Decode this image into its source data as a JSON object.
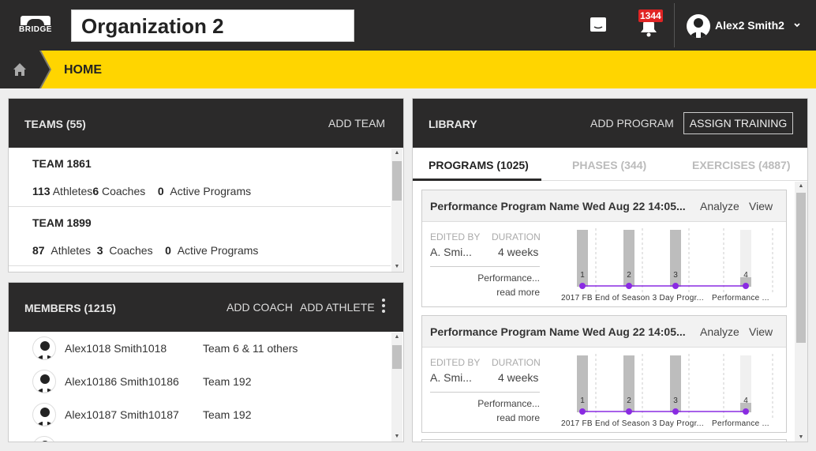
{
  "header": {
    "logo_text": "BRIDGE",
    "organization": "Organization 2",
    "notification_count": "1344",
    "user_name": "Alex2 Smith2"
  },
  "breadcrumb": {
    "current": "HOME"
  },
  "teams": {
    "title": "TEAMS (55)",
    "add_label": "ADD TEAM",
    "rows": [
      {
        "name": "TEAM 1861",
        "athletes": "113",
        "athletes_label": "Athletes",
        "coaches": "6",
        "coaches_label": "Coaches",
        "programs": "0",
        "programs_label": "Active Programs"
      },
      {
        "name": "TEAM 1899",
        "athletes": "87",
        "athletes_label": "Athletes",
        "coaches": "3",
        "coaches_label": "Coaches",
        "programs": "0",
        "programs_label": "Active Programs"
      }
    ]
  },
  "members": {
    "title": "MEMBERS (1215)",
    "add_coach": "ADD COACH",
    "add_athlete": "ADD ATHLETE",
    "rows": [
      {
        "name": "Alex1018 Smith1018",
        "team": "Team 6 & 11 others"
      },
      {
        "name": "Alex10186 Smith10186",
        "team": "Team 192"
      },
      {
        "name": "Alex10187 Smith10187",
        "team": "Team 192"
      }
    ]
  },
  "library": {
    "title": "LIBRARY",
    "add_program": "ADD PROGRAM",
    "assign_training": "ASSIGN TRAINING",
    "tabs": [
      {
        "label": "PROGRAMS (1025)",
        "active": true
      },
      {
        "label": "PHASES (344)",
        "active": false
      },
      {
        "label": "EXERCISES (4887)",
        "active": false
      }
    ],
    "cards": [
      {
        "title": "Performance Program Name Wed Aug 22 14:05...",
        "analyze": "Analyze",
        "view": "View",
        "edited_by_label": "EDITED BY",
        "edited_by": "A. Smi...",
        "duration_label": "DURATION",
        "duration": "4 weeks",
        "description": "Performance...",
        "read_more": "read more",
        "weeks": [
          "1",
          "2",
          "3",
          "4"
        ],
        "week_labels": [
          "2017 FB End of Season 3 Day Progr...",
          "Performance ..."
        ]
      },
      {
        "title": "Performance Program Name Wed Aug 22 14:05...",
        "analyze": "Analyze",
        "view": "View",
        "edited_by_label": "EDITED BY",
        "edited_by": "A. Smi...",
        "duration_label": "DURATION",
        "duration": "4 weeks",
        "description": "Performance...",
        "read_more": "read more",
        "weeks": [
          "1",
          "2",
          "3",
          "4"
        ],
        "week_labels": [
          "2017 FB End of Season 3 Day Progr...",
          "Performance ..."
        ]
      }
    ]
  },
  "colors": {
    "topbar": "#2b2a2a",
    "accent_yellow": "#ffd500",
    "badge_red": "#e02424",
    "timeline_purple": "#8a2be2",
    "bar_gray": "#bdbdbd"
  }
}
